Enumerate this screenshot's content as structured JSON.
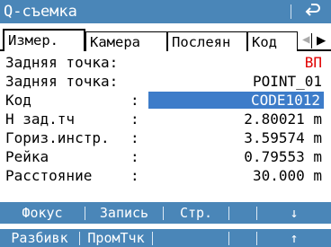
{
  "title_bar": {
    "title": "Q-съемка",
    "back_icon": "back-arrow-icon"
  },
  "tabs": [
    {
      "label": "Измер.",
      "active": true
    },
    {
      "label": "Камера",
      "active": false
    },
    {
      "label": "Послеян",
      "active": false
    },
    {
      "label": "Код",
      "active": false
    }
  ],
  "tab_scroll": {
    "left": "◀",
    "right": "▶"
  },
  "fields": {
    "backsight": {
      "label": "Задняя точка:",
      "value": "ВП"
    },
    "backsight_point": {
      "label": "Задняя точка:",
      "value": "POINT_01"
    },
    "code": {
      "label": "Код",
      "colon": ":",
      "value": "CODE1012"
    },
    "h_back": {
      "label": "H зад.тч",
      "colon": ":",
      "value": "2.80021 m"
    },
    "hz_instr": {
      "label": "Гориз.инстр.",
      "colon": ":",
      "value": "3.59574 m"
    },
    "rod": {
      "label": "Рейка",
      "colon": ":",
      "value": "0.79553 m"
    },
    "distance": {
      "label": "Расстояние",
      "colon": ":",
      "value": "30.000 m"
    }
  },
  "softkeys_row1": {
    "k1": "Фокус",
    "k2": "Запись",
    "k3": "Стр.",
    "k4": "",
    "arrow": "↓"
  },
  "softkeys_row2": {
    "k1": "Разбивк",
    "k2": "ПромТчк",
    "k3": "",
    "k4": "",
    "arrow": "↑"
  },
  "colors": {
    "bar": "#4a86b8",
    "highlight": "#3d7cc9",
    "accent_red": "#e00000"
  }
}
